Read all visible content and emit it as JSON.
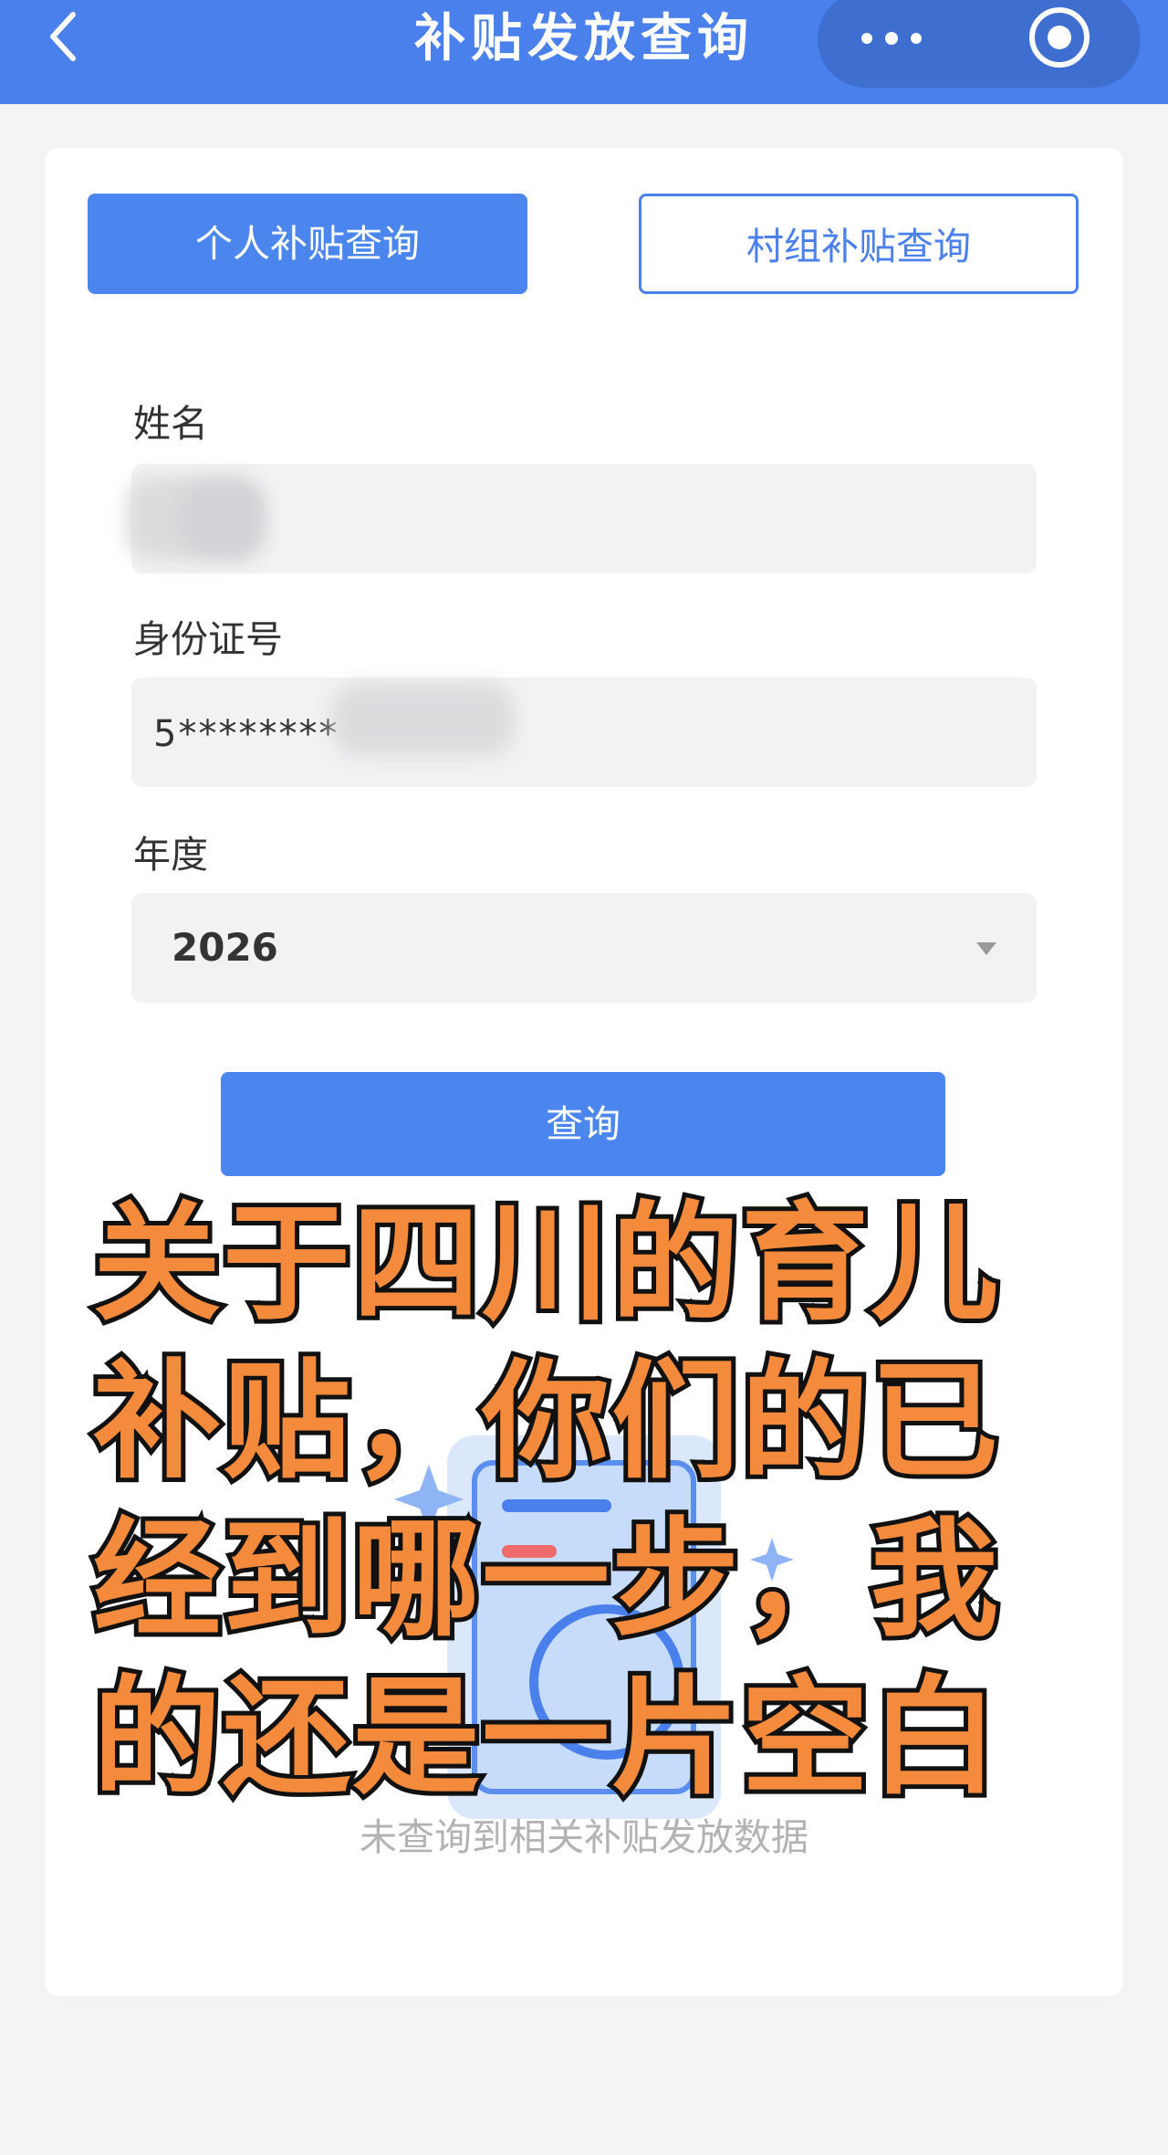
{
  "header": {
    "title": "补贴发放查询",
    "background": "#4a80ec",
    "back_icon": "chevron-left-icon",
    "more_icon": "more-dots-icon",
    "close_icon": "target-close-icon"
  },
  "tabs": [
    {
      "label": "个人补贴查询",
      "active": true
    },
    {
      "label": "村组补贴查询",
      "active": false
    }
  ],
  "form": {
    "name": {
      "label": "姓名",
      "value": ""
    },
    "id_number": {
      "label": "身份证号",
      "value": "5********"
    },
    "year": {
      "label": "年度",
      "value": "2026"
    },
    "submit_label": "查询"
  },
  "result": {
    "empty_text": "未查询到相关补贴发放数据"
  },
  "overlay_caption": {
    "lines": [
      "关于四川的育儿",
      "补贴，你们的已",
      "经到哪一步，我",
      "的还是一片空白"
    ],
    "fill_color": "#f48b3c",
    "stroke_color": "#111111"
  },
  "colors": {
    "accent": "#4a80ec",
    "page_background": "#f4f4f5"
  }
}
